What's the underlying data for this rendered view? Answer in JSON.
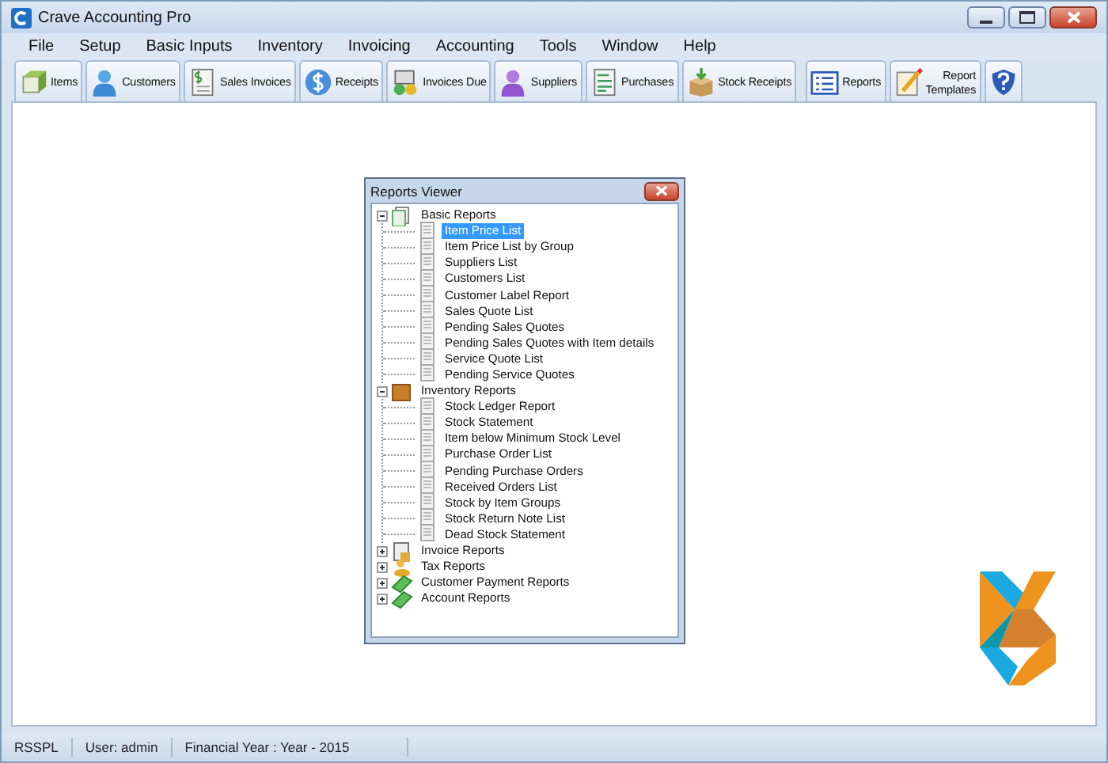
{
  "window": {
    "title": "Crave Accounting Pro"
  },
  "menu": [
    "File",
    "Setup",
    "Basic Inputs",
    "Inventory",
    "Invoicing",
    "Accounting",
    "Tools",
    "Window",
    "Help"
  ],
  "toolbar": {
    "groups": [
      [
        {
          "kind": "labeled",
          "label": "Items"
        },
        {
          "kind": "labeled",
          "label": "Customers"
        },
        {
          "kind": "labeled",
          "label": "Sales Invoices"
        },
        {
          "kind": "labeled",
          "label": "Receipts"
        },
        {
          "kind": "labeled",
          "label": "Invoices Due"
        },
        {
          "kind": "labeled",
          "label": "Suppliers"
        },
        {
          "kind": "labeled",
          "label": "Purchases"
        },
        {
          "kind": "labeled",
          "label": "Stock Receipts"
        }
      ],
      [
        {
          "kind": "labeled",
          "label": "Reports"
        },
        {
          "kind": "labeled",
          "label": "Report Templates"
        },
        {
          "kind": "icon"
        }
      ]
    ]
  },
  "reports_viewer": {
    "title": "Reports Viewer",
    "tree": [
      {
        "label": "Basic Reports",
        "expanded": true,
        "selected": false,
        "children": [
          {
            "label": "Item Price List",
            "selected": true
          },
          {
            "label": "Item Price List by Group",
            "selected": false
          },
          {
            "label": "Suppliers List",
            "selected": false
          },
          {
            "label": "Customers List",
            "selected": false
          },
          {
            "label": "Customer Label Report",
            "selected": false
          },
          {
            "label": "Sales Quote List",
            "selected": false
          },
          {
            "label": "Pending Sales Quotes",
            "selected": false
          },
          {
            "label": "Pending Sales Quotes with Item details",
            "selected": false
          },
          {
            "label": "Service Quote List",
            "selected": false
          },
          {
            "label": "Pending Service Quotes",
            "selected": false
          }
        ]
      },
      {
        "label": "Inventory Reports",
        "expanded": true,
        "selected": false,
        "children": [
          {
            "label": "Stock Ledger Report",
            "selected": false
          },
          {
            "label": "Stock Statement",
            "selected": false
          },
          {
            "label": "Item below Minimum Stock Level",
            "selected": false
          },
          {
            "label": "Purchase Order List",
            "selected": false
          },
          {
            "label": "Pending Purchase Orders",
            "selected": false
          },
          {
            "label": "Received Orders List",
            "selected": false
          },
          {
            "label": "Stock by Item Groups",
            "selected": false
          },
          {
            "label": "Stock Return Note List",
            "selected": false
          },
          {
            "label": "Dead Stock Statement",
            "selected": false
          }
        ]
      },
      {
        "label": "Invoice Reports",
        "expanded": false,
        "selected": false
      },
      {
        "label": "Tax Reports",
        "expanded": false,
        "selected": false
      },
      {
        "label": "Customer Payment Reports",
        "expanded": false,
        "selected": false
      },
      {
        "label": "Account Reports",
        "expanded": false,
        "selected": false
      }
    ]
  },
  "status_bar": [
    "RSSPL",
    "User: admin",
    "Financial Year : Year - 2015"
  ]
}
